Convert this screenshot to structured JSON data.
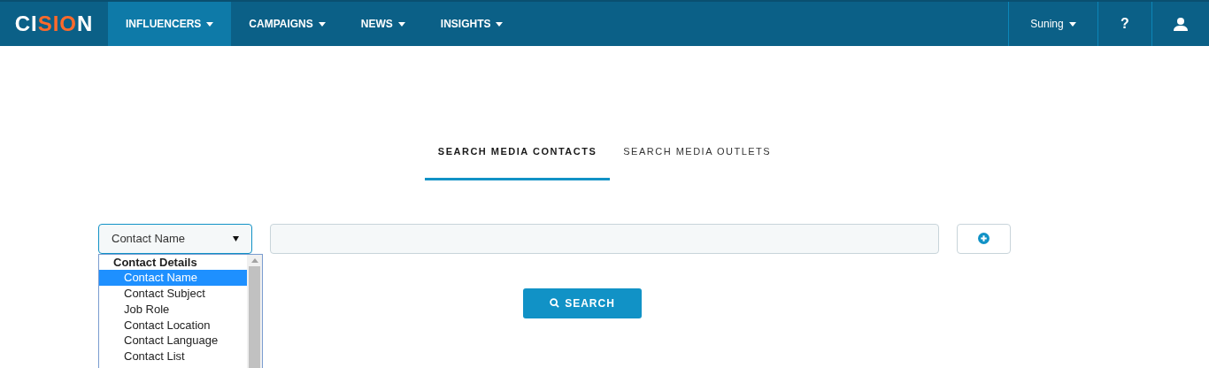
{
  "logo": "CISION",
  "nav": [
    {
      "label": "INFLUENCERS",
      "selected": true
    },
    {
      "label": "CAMPAIGNS",
      "selected": false
    },
    {
      "label": "NEWS",
      "selected": false
    },
    {
      "label": "INSIGHTS",
      "selected": false
    }
  ],
  "account": {
    "label": "Suning"
  },
  "help": {
    "label": "?"
  },
  "tabs": [
    {
      "label": "SEARCH MEDIA CONTACTS",
      "selected": true
    },
    {
      "label": "SEARCH MEDIA OUTLETS",
      "selected": false
    }
  ],
  "field_select": {
    "value": "Contact Name",
    "expanded": true
  },
  "dropdown": {
    "group": "Contact Details",
    "options": [
      {
        "label": "Contact Name",
        "selected": true
      },
      {
        "label": "Contact Subject",
        "selected": false
      },
      {
        "label": "Job Role",
        "selected": false
      },
      {
        "label": "Contact Location",
        "selected": false
      },
      {
        "label": "Contact Language",
        "selected": false
      },
      {
        "label": "Contact List",
        "selected": false
      }
    ]
  },
  "search_button": {
    "label": "SEARCH"
  }
}
